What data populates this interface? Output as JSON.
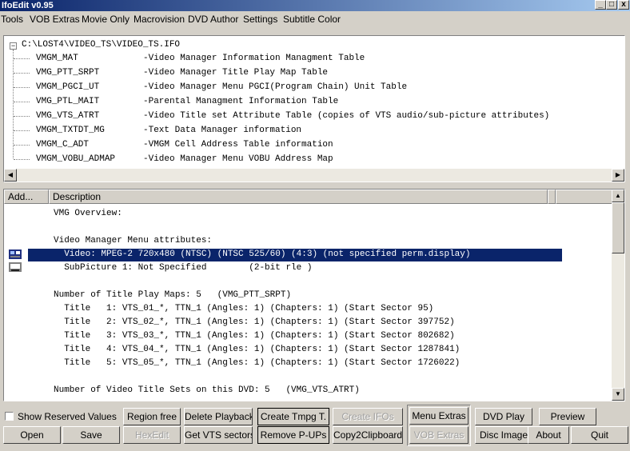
{
  "window": {
    "title": "IfoEdit v0.95",
    "minimize": "_",
    "restore": "□",
    "close": "x"
  },
  "menu": [
    "Tools",
    "VOB Extras",
    "Movie Only",
    "Macrovision",
    "DVD Author",
    "Settings",
    "Subtitle Color"
  ],
  "tree": {
    "expander": "−",
    "root": "C:\\LOST4\\VIDEO_TS\\VIDEO_TS.IFO",
    "items": [
      {
        "name": "VMGM_MAT",
        "desc": "-Video Manager Information Managment Table"
      },
      {
        "name": "VMG_PTT_SRPT",
        "desc": "-Video Manager Title Play Map Table"
      },
      {
        "name": "VMGM_PGCI_UT",
        "desc": "-Video Manager Menu PGCI(Program Chain) Unit Table"
      },
      {
        "name": "VMG_PTL_MAIT",
        "desc": "-Parental Managment Information Table"
      },
      {
        "name": "VMG_VTS_ATRT",
        "desc": "-Video Title set Attribute Table (copies of VTS audio/sub-picture attributes)"
      },
      {
        "name": "VMGM_TXTDT_MG",
        "desc": "-Text Data Manager information"
      },
      {
        "name": "VMGM_C_ADT",
        "desc": "-VMGM Cell Address Table information"
      },
      {
        "name": "VMGM_VOBU_ADMAP",
        "desc": "-Video Manager Menu VOBU Address Map"
      }
    ],
    "scroll_left": "◀",
    "scroll_right": "▶"
  },
  "details": {
    "columns": [
      "Add...",
      "Description"
    ],
    "lines": [
      "VMG Overview:",
      "",
      "Video Manager Menu attributes:",
      "  Video: MPEG-2 720x480 (NTSC) (NTSC 525/60) (4:3) (not specified perm.display)",
      "  SubPicture 1: Not Specified        (2-bit rle )",
      "",
      "Number of Title Play Maps: 5   (VMG_PTT_SRPT)",
      "  Title   1: VTS_01_*, TTN_1 (Angles: 1) (Chapters: 1) (Start Sector 95)",
      "  Title   2: VTS_02_*, TTN_1 (Angles: 1) (Chapters: 1) (Start Sector 397752)",
      "  Title   3: VTS_03_*, TTN_1 (Angles: 1) (Chapters: 1) (Start Sector 802682)",
      "  Title   4: VTS_04_*, TTN_1 (Angles: 1) (Chapters: 1) (Start Sector 1287841)",
      "  Title   5: VTS_05_*, TTN_1 (Angles: 1) (Chapters: 1) (Start Sector 1726022)",
      "",
      "Number of Video Title Sets on this DVD: 5   (VMG_VTS_ATRT)"
    ],
    "selected_line": 3,
    "scroll_up": "▲",
    "scroll_down": "▼"
  },
  "controls": {
    "show_reserved": "Show Reserved Values",
    "region_free": "Region free",
    "delete_playback": "Delete Playback",
    "create_tmpg": "Create Tmpg T.",
    "create_ifos": "Create IFOs",
    "menu_extras": "Menu Extras",
    "dvd_play": "DVD Play",
    "preview": "Preview",
    "open": "Open",
    "save": "Save",
    "hexedit": "HexEdit",
    "get_vts_sectors": "Get VTS sectors",
    "remove_pups": "Remove P-UPs",
    "copy2clipboard": "Copy2Clipboard",
    "vob_extras": "VOB Extras",
    "disc_image": "Disc Image",
    "about": "About",
    "quit": "Quit"
  },
  "colors": {
    "selection": "#0a246a",
    "face": "#d4d0c8"
  }
}
